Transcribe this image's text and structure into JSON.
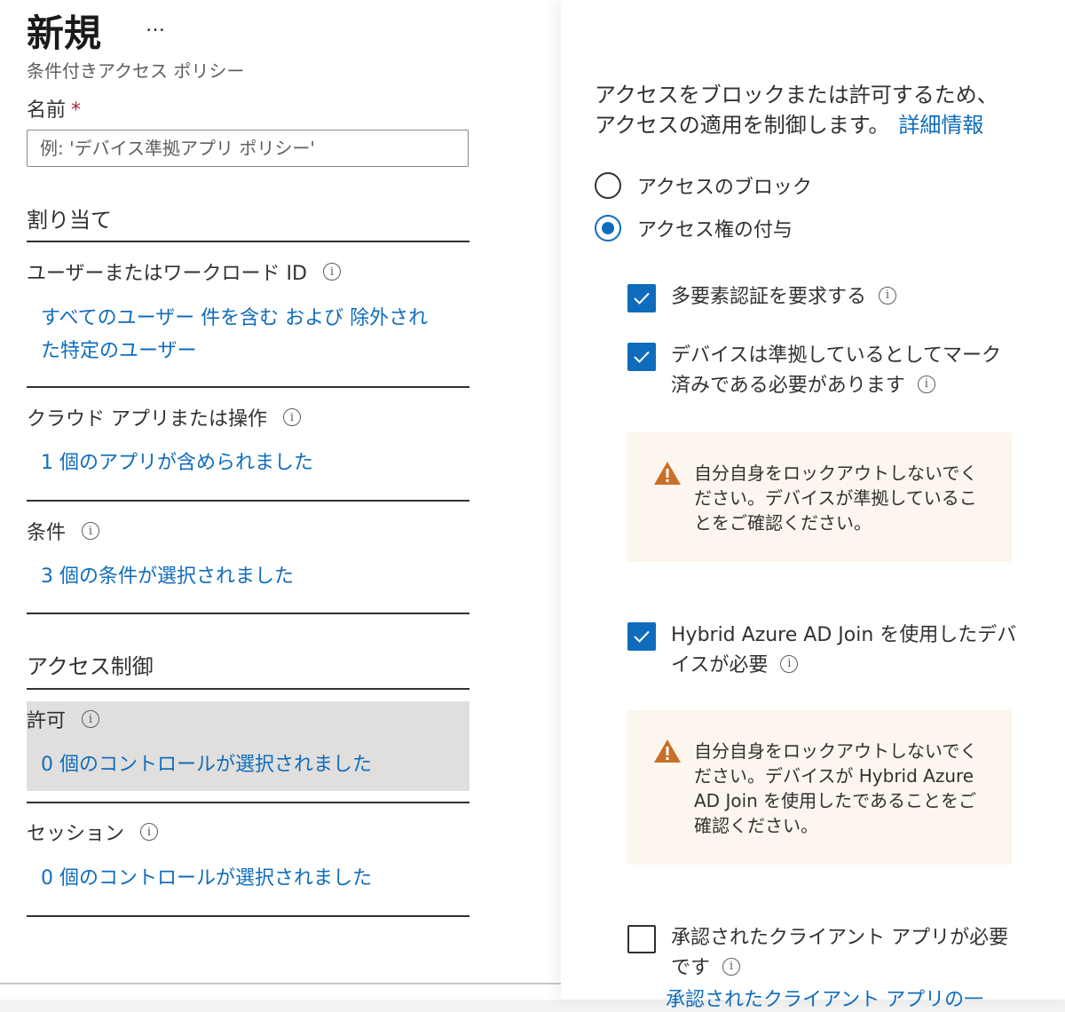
{
  "header": {
    "title": "新規",
    "more": "…",
    "subtitle": "条件付きアクセス ポリシー"
  },
  "name_field": {
    "label": "名前",
    "required_mark": "*",
    "placeholder": "例: 'デバイス準拠アプリ ポリシー'"
  },
  "assignments": {
    "heading": "割り当て",
    "users": {
      "title": "ユーザーまたはワークロード ID",
      "link_line1": "すべてのユーザー 件を含む および 除外され",
      "link_line2": "た特定のユーザー"
    },
    "cloud_apps": {
      "title": "クラウド アプリまたは操作",
      "link": "1 個のアプリが含められました"
    },
    "conditions": {
      "title": "条件",
      "link": "3 個の条件が選択されました"
    }
  },
  "access_controls": {
    "heading": "アクセス制御",
    "grant": {
      "title": "許可",
      "link": "0 個のコントロールが選択されました"
    },
    "session": {
      "title": "セッション",
      "link": "0 個のコントロールが選択されました"
    }
  },
  "grant_panel": {
    "intro_line1": "アクセスをブロックまたは許可するため、",
    "intro_line2": "アクセスの適用を制御します。",
    "learn_more": "詳細情報",
    "radio_block": "アクセスのブロック",
    "radio_grant": "アクセス権の付与",
    "selected": "grant",
    "options": {
      "mfa": {
        "label": "多要素認証を要求する",
        "checked": true
      },
      "compliant": {
        "label": "デバイスは準拠しているとしてマーク済みである必要があります",
        "checked": true
      },
      "hybrid": {
        "label": "Hybrid Azure AD Join を使用したデバイスが必要",
        "checked": true
      },
      "approved_app": {
        "label": "承認されたクライアント アプリが必要です",
        "checked": false
      }
    },
    "warning_compliant": "自分自身をロックアウトしないでください。デバイスが準拠していることをご確認ください。",
    "warning_hybrid": "自分自身をロックアウトしないでください。デバイスが Hybrid Azure AD Join を使用したであることをご確認ください。",
    "cut_link": "承認されたクライアント アプリの一"
  },
  "colors": {
    "link": "#0f6cbd",
    "checkbox": "#0f6cbd",
    "warning_bg": "#fdf6ee",
    "warning_icon": "#c8702a",
    "highlight": "#e1dfdd"
  }
}
